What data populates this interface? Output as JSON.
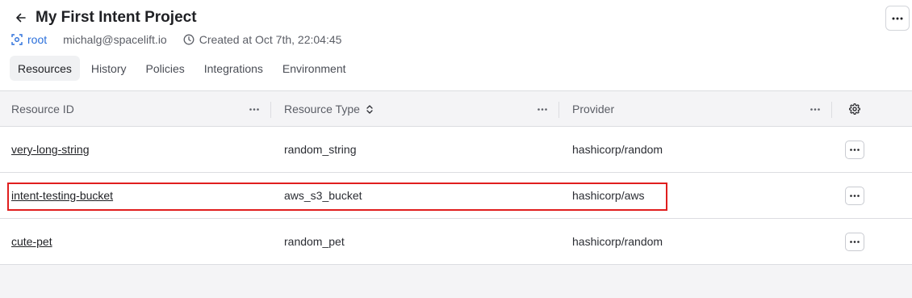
{
  "header": {
    "title": "My First Intent Project",
    "space": "root",
    "user": "michalg@spacelift.io",
    "created": "Created at Oct 7th, 22:04:45"
  },
  "tabs": [
    {
      "label": "Resources",
      "active": true
    },
    {
      "label": "History"
    },
    {
      "label": "Policies"
    },
    {
      "label": "Integrations"
    },
    {
      "label": "Environment"
    }
  ],
  "table": {
    "columns": [
      {
        "label": "Resource ID"
      },
      {
        "label": "Resource Type",
        "sortable": true
      },
      {
        "label": "Provider"
      }
    ],
    "rows": [
      {
        "id": "very-long-string",
        "type": "random_string",
        "provider": "hashicorp/random"
      },
      {
        "id": "intent-testing-bucket",
        "type": "aws_s3_bucket",
        "provider": "hashicorp/aws",
        "highlighted": true
      },
      {
        "id": "cute-pet",
        "type": "random_pet",
        "provider": "hashicorp/random"
      }
    ]
  },
  "icons": {
    "back": "arrow-left-icon",
    "space": "space-icon",
    "clock": "clock-icon",
    "more": "more-horizontal-icon",
    "sort": "sort-icon",
    "settings": "gear-icon"
  },
  "colors": {
    "accent": "#2a6fdb",
    "highlight": "#e01e1e",
    "table_bg": "#f4f4f6"
  }
}
